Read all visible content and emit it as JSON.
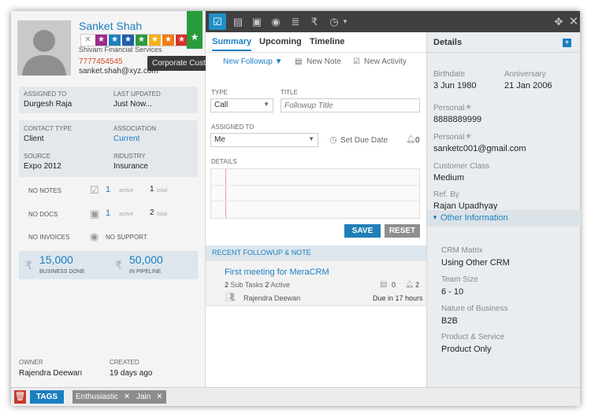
{
  "contact": {
    "name": "Sanket Shah",
    "company": "Shivam Financial Services",
    "phone": "7777454545",
    "email": "sanket.shah@xyz.com",
    "tooltip": "Corporate Customer"
  },
  "left": {
    "assigned_to_label": "ASSIGNED TO",
    "assigned_to": "Durgesh Raja",
    "last_updated_label": "LAST UPDATED",
    "last_updated": "Just Now...",
    "contact_type_label": "CONTACT TYPE",
    "contact_type": "Client",
    "association_label": "ASSOCIATION",
    "association": "Current",
    "source_label": "SOURCE",
    "source": "Expo 2012",
    "industry_label": "INDUSTRY",
    "industry": "Insurance",
    "notes_label": "NO NOTES",
    "notes_active": "1",
    "notes_active_label": "active",
    "notes_total": "1",
    "notes_total_label": "total",
    "docs_label": "NO DOCS",
    "docs_active": "1",
    "docs_active_label": "active",
    "docs_total": "2",
    "docs_total_label": "total",
    "invoices_label": "NO INVOICES",
    "support_label": "NO SUPPORT",
    "business_done": "15,000",
    "business_done_label": "BUSINESS DONE",
    "in_pipeline": "50,000",
    "in_pipeline_label": "IN PIPELINE",
    "owner_label": "OWNER",
    "owner": "Rajendra Deewan",
    "created_label": "CREATED",
    "created": "19 days ago"
  },
  "tags": {
    "label": "TAGS",
    "items": [
      "Enthusiastic",
      "Jain"
    ]
  },
  "middle": {
    "tabs": [
      "Summary",
      "Upcoming",
      "Timeline"
    ],
    "new_followup": "New Followup",
    "new_note": "New Note",
    "new_activity": "New Activity",
    "type_label": "TYPE",
    "type_value": "Call",
    "title_label": "TITLE",
    "title_placeholder": "Followup Title",
    "assigned_label": "ASSIGNED TO",
    "assigned_value": "Me",
    "set_due_date": "Set Due Date",
    "alarm_count": "0",
    "details_label": "DETAILS",
    "save": "SAVE",
    "reset": "RESET",
    "recent_header": "RECENT FOLLOWUP & NOTE",
    "recent": {
      "title": "First meeting for MeraCRM",
      "subtasks_count": "2",
      "subtasks_label": "Sub Tasks",
      "active_count": "2",
      "active_label": "Active",
      "notes_count": "0",
      "alarm_count": "2",
      "person": "Rajendra Deewan",
      "due": "Due in 17 hours"
    }
  },
  "right": {
    "header": "Details",
    "birthdate_label": "Birthdate",
    "birthdate": "3 Jun 1980",
    "anniversary_label": "Anniversary",
    "anniversary": "21 Jan 2006",
    "personal1_label": "Personal",
    "personal1": "8888889999",
    "personal2_label": "Personal",
    "personal2": "sanketc001@gmail.com",
    "class_label": "Customer Class",
    "class": "Medium",
    "ref_label": "Ref. By",
    "ref": "Rajan Upadhyay",
    "other_header": "Other Information",
    "crm_label": "CRM Matrix",
    "crm": "Using Other CRM",
    "team_label": "Team Size",
    "team": "6 - 10",
    "nature_label": "Nature of Business",
    "nature": "B2B",
    "product_label": "Product & Service",
    "product": "Product Only"
  },
  "colors": {
    "accent": "#1a7fc1",
    "ribbon": "#2a9b3c",
    "save": "#1f7fb6",
    "reset": "#8e8e8e",
    "phone": "#d14a2a"
  },
  "star_colors": [
    "#ffffff",
    "#9c2a8d",
    "#1a7fc1",
    "#1f5fa8",
    "#2a9b3c",
    "#f2b21a",
    "#f27a1a",
    "#d6322a"
  ]
}
